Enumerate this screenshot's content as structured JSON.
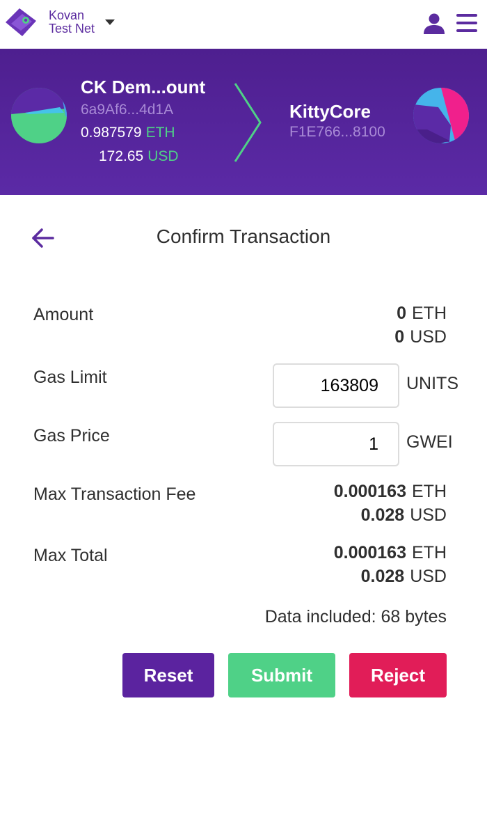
{
  "header": {
    "network_line1": "Kovan",
    "network_line2": "Test Net",
    "icons": {
      "logo": "wallet-logo-icon",
      "caret": "caret-down-icon",
      "account": "user-icon",
      "menu": "hamburger-menu-icon"
    },
    "colors": {
      "brand": "#5b2b9f"
    }
  },
  "banner": {
    "from": {
      "name": "CK Dem...ount",
      "address": "6a9Af6...4d1A",
      "balance": "0.987579",
      "balance_unit": "ETH",
      "usd": "172.65",
      "usd_unit": "USD"
    },
    "to": {
      "name": "KittyCore",
      "address": "F1E766...8100"
    },
    "colors": {
      "background": "#4e1f8f",
      "accent": "#4fd187",
      "muted": "#a98bd6"
    }
  },
  "confirm": {
    "title": "Confirm Transaction",
    "amount": {
      "label": "Amount",
      "eth": "0",
      "eth_unit": "ETH",
      "usd": "0",
      "usd_unit": "USD"
    },
    "gas_limit": {
      "label": "Gas Limit",
      "value": "163809",
      "unit": "UNITS"
    },
    "gas_price": {
      "label": "Gas Price",
      "value": "1",
      "unit": "GWEI"
    },
    "max_fee": {
      "label": "Max Transaction Fee",
      "eth": "0.000163",
      "eth_unit": "ETH",
      "usd": "0.028",
      "usd_unit": "USD"
    },
    "max_total": {
      "label": "Max Total",
      "eth": "0.000163",
      "eth_unit": "ETH",
      "usd": "0.028",
      "usd_unit": "USD"
    },
    "data_included": "Data included: 68 bytes"
  },
  "actions": {
    "reset": "Reset",
    "submit": "Submit",
    "reject": "Reject",
    "colors": {
      "reset": "#5b239f",
      "submit": "#4fd187",
      "reject": "#e11d58"
    }
  }
}
